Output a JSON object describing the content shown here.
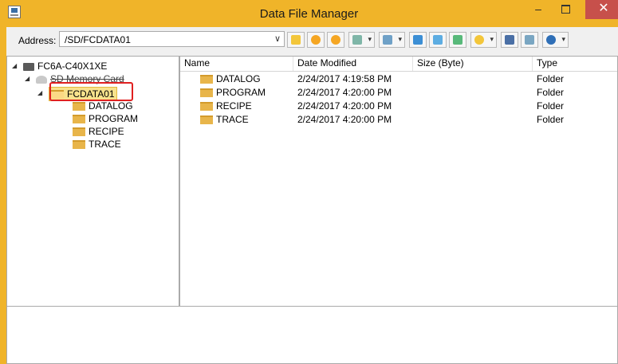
{
  "window": {
    "title": "Data File Manager",
    "minimize_glyph": "–",
    "close_glyph": "✕"
  },
  "toolbar": {
    "address_label": "Address:",
    "address_value": "/SD/FCDATA01",
    "dropdown_glyph": "∨",
    "tool_icons": [
      "download-icon",
      "start-icon",
      "stop-icon",
      "view-icon",
      "view2-icon",
      "upload-icon",
      "move-down-icon",
      "move-up-icon",
      "settings-icon",
      "database-icon",
      "file-icon",
      "help-icon"
    ]
  },
  "tree": {
    "device": "FC6A-C40X1XE",
    "card": "SD Memory Card",
    "selected": "FCDATA01",
    "children": [
      "DATALOG",
      "PROGRAM",
      "RECIPE",
      "TRACE"
    ]
  },
  "list": {
    "columns": [
      "Name",
      "Date Modified",
      "Size (Byte)",
      "Type"
    ],
    "rows": [
      {
        "name": "DATALOG",
        "date": "2/24/2017 4:19:58 PM",
        "size": "",
        "type": "Folder"
      },
      {
        "name": "PROGRAM",
        "date": "2/24/2017 4:20:00 PM",
        "size": "",
        "type": "Folder"
      },
      {
        "name": "RECIPE",
        "date": "2/24/2017 4:20:00 PM",
        "size": "",
        "type": "Folder"
      },
      {
        "name": "TRACE",
        "date": "2/24/2017 4:20:00 PM",
        "size": "",
        "type": "Folder"
      }
    ]
  },
  "colors": {
    "title_bar": "#f0b429",
    "close_button": "#c7504b",
    "highlight_border": "#e02020",
    "folder": "#e8b54a"
  }
}
